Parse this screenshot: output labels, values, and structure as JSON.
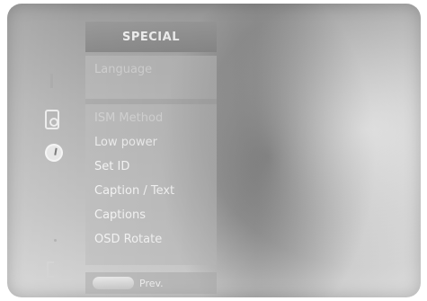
{
  "menu": {
    "title": "SPECIAL",
    "items": [
      {
        "label": "Language",
        "state": "faded"
      },
      {
        "label": "ISM Method",
        "state": "faded"
      },
      {
        "label": "Low power",
        "state": "dim"
      },
      {
        "label": "Set ID",
        "state": "normal"
      },
      {
        "label": "Caption / Text",
        "state": "normal"
      },
      {
        "label": "Captions",
        "state": "normal"
      },
      {
        "label": "OSD Rotate",
        "state": "normal"
      }
    ]
  },
  "footer": {
    "prev_label": "Prev."
  },
  "icons": [
    "bar-icon",
    "speaker-icon",
    "clock-icon",
    "dot-icon",
    "bracket-icon"
  ]
}
